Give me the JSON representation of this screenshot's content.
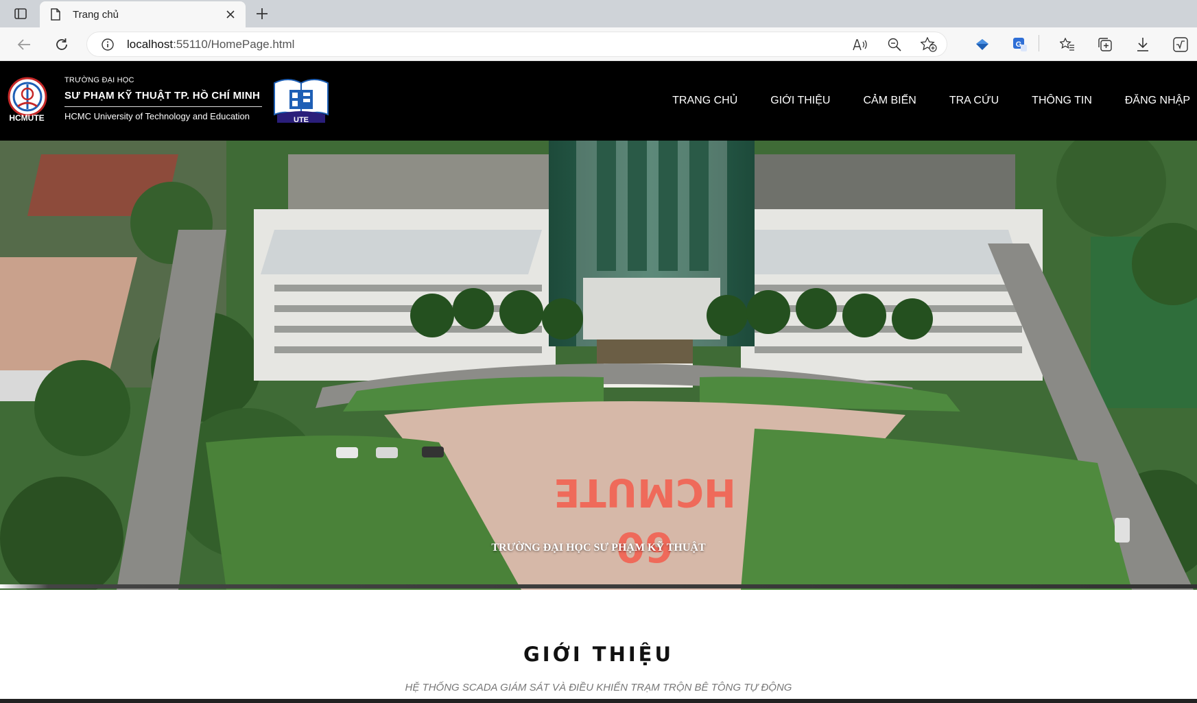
{
  "browser": {
    "tab_title": "Trang chủ",
    "url_host": "localhost",
    "url_rest": ":55110/HomePage.html"
  },
  "site": {
    "logo_caption": "HCMUTE",
    "uni_small": "TRƯỜNG ĐẠI HỌC",
    "uni_big": "SƯ PHẠM KỸ THUẬT TP. HỒ CHÍ MINH",
    "uni_en": "HCMC University of Technology and Education",
    "ute_label": "UTE",
    "nav": [
      {
        "label": "TRANG CHỦ"
      },
      {
        "label": "GIỚI THIỆU"
      },
      {
        "label": "CẢM BIẾN"
      },
      {
        "label": "TRA CỨU"
      },
      {
        "label": "THÔNG TIN"
      },
      {
        "label": "ĐĂNG NHẬP"
      }
    ]
  },
  "hero": {
    "caption": "TRƯỜNG ĐẠI HỌC SƯ PHẠM KỸ THUẬT",
    "ground_text": "HCMUTE",
    "ground_number": "60"
  },
  "intro": {
    "title": "GIỚI THIỆU",
    "subtitle": "HỆ THỐNG SCADA GIÁM SÁT VÀ ĐIỀU KHIỂN TRẠM TRỘN BÊ TÔNG TỰ ĐỘNG"
  },
  "colors": {
    "header_bg": "#000000",
    "accent_blue": "#1e5fb5"
  }
}
